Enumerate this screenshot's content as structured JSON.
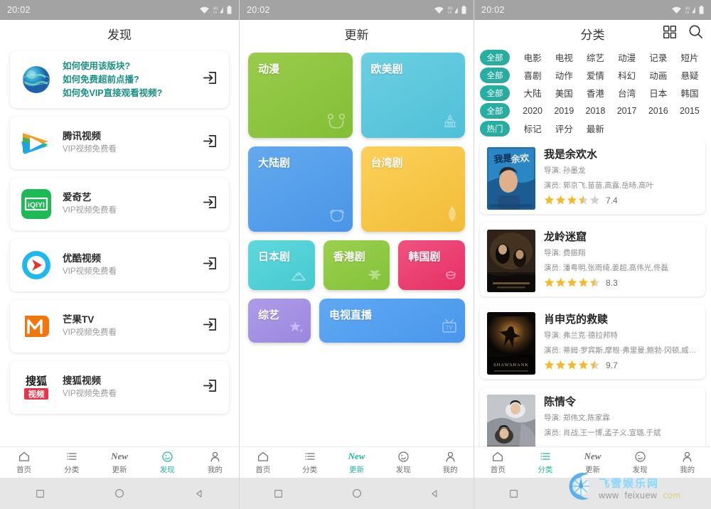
{
  "status_bar": {
    "time": "20:02",
    "wifi_icon": "wifi-icon",
    "signal_icon": "signal-4g-icon",
    "battery_icon": "battery-icon"
  },
  "screens": [
    {
      "id": "discover",
      "title": "发现",
      "help_card": {
        "icon": "globe-icon",
        "lines": [
          "如何使用该版块?",
          "如何免费超前点播?",
          "如何免VIP直接观看视频?"
        ],
        "action_icon": "enter-arrow-icon"
      },
      "providers": [
        {
          "name": "腾讯视频",
          "sub": "VIP视频免费看",
          "icon": "tencent-video-icon",
          "action_icon": "enter-arrow-icon"
        },
        {
          "name": "爱奇艺",
          "sub": "VIP视频免费看",
          "icon": "iqiyi-icon",
          "action_icon": "enter-arrow-icon"
        },
        {
          "name": "优酷视频",
          "sub": "VIP视频免费看",
          "icon": "youku-icon",
          "action_icon": "enter-arrow-icon"
        },
        {
          "name": "芒果TV",
          "sub": "VIP视频免费看",
          "icon": "mangotv-icon",
          "action_icon": "enter-arrow-icon"
        },
        {
          "name": "搜狐视频",
          "sub": "VIP视频免费看",
          "icon": "sohu-video-icon",
          "action_icon": "enter-arrow-icon"
        }
      ],
      "bottom_nav": {
        "active": "发现"
      }
    },
    {
      "id": "update",
      "title": "更新",
      "tiles": [
        {
          "label": "动漫",
          "color": "#8cc63f",
          "color2": "#9ad04e",
          "icon": "bear-face-icon"
        },
        {
          "label": "欧美剧",
          "color": "#5bc8dd",
          "color2": "#6ed2e4",
          "icon": "capitol-icon"
        },
        {
          "label": "大陆剧",
          "color": "#559ee8",
          "color2": "#62a8ee",
          "icon": "panda-icon"
        },
        {
          "label": "台湾剧",
          "color": "#f5c243",
          "color2": "#fbd05b",
          "icon": "leaf-icon"
        },
        {
          "label": "日本剧",
          "color": "#4fcfd4",
          "color2": "#5fd9dd",
          "icon": "fuji-icon"
        },
        {
          "label": "香港剧",
          "color": "#8cc63f",
          "color2": "#9ad04e",
          "icon": "bauhinia-icon"
        },
        {
          "label": "韩国剧",
          "color": "#ea3f70",
          "color2": "#f0527f",
          "icon": "kimchi-pot-icon"
        },
        {
          "label": "综艺",
          "color": "#a08ee0",
          "color2": "#ae9ce8",
          "icon": "star-icon"
        },
        {
          "label": "电视直播",
          "color": "#4f9ef0",
          "color2": "#5fa9f3",
          "icon": "tv-icon"
        }
      ],
      "bottom_nav": {
        "active": "更新"
      }
    },
    {
      "id": "category",
      "title": "分类",
      "header_icons": [
        "grid-icon",
        "search-icon"
      ],
      "filter_rows": [
        {
          "all_label": "全部",
          "options": [
            "电影",
            "电视",
            "综艺",
            "动漫",
            "记录",
            "短片"
          ]
        },
        {
          "all_label": "全部",
          "options": [
            "喜剧",
            "动作",
            "爱情",
            "科幻",
            "动画",
            "悬疑"
          ]
        },
        {
          "all_label": "全部",
          "options": [
            "大陆",
            "美国",
            "香港",
            "台湾",
            "日本",
            "韩国"
          ]
        },
        {
          "all_label": "全部",
          "options": [
            "2020",
            "2019",
            "2018",
            "2017",
            "2016",
            "2015"
          ]
        },
        {
          "all_label": "热门",
          "options": [
            "标记",
            "评分",
            "最新"
          ]
        }
      ],
      "movies": [
        {
          "title": "我是余欢水",
          "director_label": "导演:",
          "director": "孙墨龙",
          "cast_label": "演员:",
          "cast": "郭京飞,苗苗,高露,岳旸,高叶",
          "score": "7.4",
          "stars": 3.5,
          "poster": "poster-wo-shi-yu-huan-shui"
        },
        {
          "title": "龙岭迷窟",
          "director_label": "导演:",
          "director": "费振翔",
          "cast_label": "演员:",
          "cast": "潘粤明,张雨绮,姜超,高伟光,佟磊",
          "score": "8.3",
          "stars": 4.5,
          "poster": "poster-long-ling-mi-ku"
        },
        {
          "title": "肖申克的救赎",
          "director_label": "导演:",
          "director": "弗兰克·德拉邦特",
          "cast_label": "演员:",
          "cast": "蒂姆·罗宾斯,摩根·弗里曼,鲍勃·冈顿,威廉姆·赛...",
          "score": "9.7",
          "stars": 4.5,
          "poster": "poster-shawshank"
        },
        {
          "title": "陈情令",
          "director_label": "导演:",
          "director": "郑伟文,陈家霖",
          "cast_label": "演员:",
          "cast": "肖战,王一博,孟子义,宣璐,于斌",
          "score": "",
          "stars": 0,
          "poster": "poster-chen-qing-ling"
        }
      ],
      "bottom_nav": {
        "active": "分类"
      }
    }
  ],
  "bottom_nav_items": [
    {
      "label": "首页",
      "icon": "home-icon"
    },
    {
      "label": "分类",
      "icon": "list-icon"
    },
    {
      "label": "更新",
      "icon": "new-icon"
    },
    {
      "label": "发现",
      "icon": "compass-icon"
    },
    {
      "label": "我的",
      "icon": "user-icon"
    }
  ],
  "android_nav": [
    {
      "icon": "square-recents-icon"
    },
    {
      "icon": "circle-home-icon"
    },
    {
      "icon": "triangle-back-icon"
    }
  ],
  "watermark": {
    "cn": "飞雪娱乐网",
    "url_part1": "www",
    "url_part2": "feixuew",
    "url_part3": "com",
    "icon": "moon-compass-icon"
  },
  "colors": {
    "accent": "#1fb39f",
    "help_text": "#1a8f84",
    "chip": "#20b2a6",
    "star": "#f5b828",
    "star_empty": "#cfcfcf"
  }
}
